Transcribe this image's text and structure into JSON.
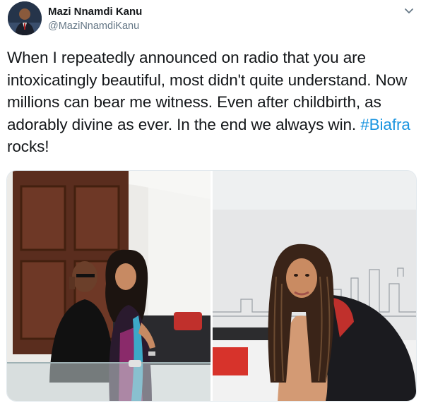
{
  "author": {
    "name": "Mazi Nnamdi Kanu",
    "handle": "@MaziNnamdiKanu",
    "avatar_icon": "user-avatar"
  },
  "menu": {
    "icon": "chevron-down-icon"
  },
  "tweet": {
    "text_before": "When I repeatedly announced on radio that you are intoxicatingly beautiful, most didn't quite understand. Now millions can bear me witness. Even after childbirth, as adorably divine as ever. In the end we always win. ",
    "hashtag": "#Biafra",
    "text_after": " rocks!"
  },
  "media": {
    "photos": [
      {
        "description_icon": "photo-couple-sofa"
      },
      {
        "description_icon": "photo-woman-braids"
      }
    ]
  },
  "colors": {
    "link": "#1b95e0",
    "text": "#14171a",
    "secondary": "#657786"
  }
}
